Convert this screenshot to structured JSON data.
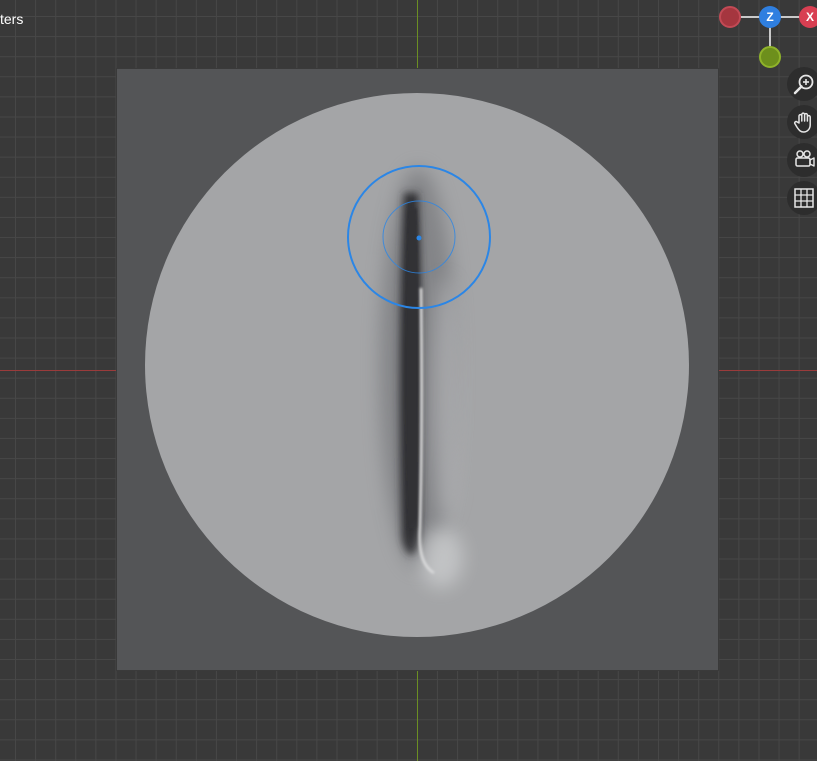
{
  "header": {
    "units_label": "ters"
  },
  "navigation_gizmo": {
    "z_label": "Z",
    "x_label": "X",
    "z_color": "#2f7fe0",
    "x_color": "#d83f52",
    "neg_x_color": "#a5363f",
    "neg_y_color": "#6d8f1c"
  },
  "toolbar": {
    "zoom_icon": "zoom-magnifier-icon",
    "pan_icon": "hand-pan-icon",
    "camera_icon": "camera-view-icon",
    "grid_icon": "grid-toggle-icon"
  },
  "colors": {
    "background": "#393939",
    "canvas": "#545557",
    "disc": "#a4a5a7",
    "brush_ring": "#2b86e6"
  }
}
